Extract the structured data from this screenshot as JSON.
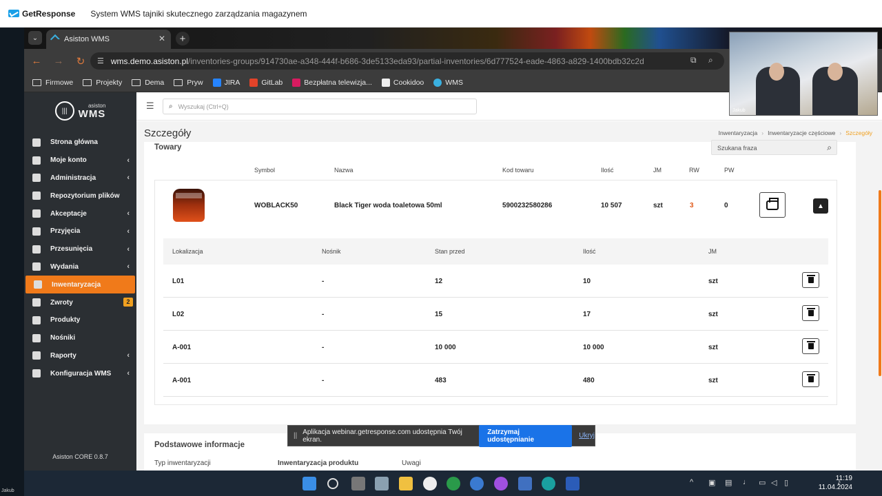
{
  "webinar": {
    "app": "GetResponse",
    "title": "System WMS tajniki skutecznego zarządzania magazynem"
  },
  "browser": {
    "tab_title": "Asiston WMS",
    "url_host": "wms.demo.asiston.pl",
    "url_path": "/inventories-groups/914730ae-a348-444f-b686-3de5133eda93/partial-inventories/6d777524-eade-4863-a829-1400bdb32c2d",
    "bookmarks": [
      "Firmowe",
      "Projekty",
      "Dema",
      "Pryw",
      "JIRA",
      "GitLab",
      "Bezpłatna telewizja...",
      "Cookidoo",
      "WMS"
    ]
  },
  "brand": {
    "small": "asiston",
    "big": "WMS"
  },
  "search": {
    "placeholder": "Wyszukaj (Ctrl+Q)"
  },
  "sidebar": {
    "items": [
      {
        "label": "Strona główna",
        "chevron": false
      },
      {
        "label": "Moje konto",
        "chevron": true
      },
      {
        "label": "Administracja",
        "chevron": true
      },
      {
        "label": "Repozytorium plików",
        "chevron": false
      },
      {
        "label": "Akceptacje",
        "chevron": true
      },
      {
        "label": "Przyjęcia",
        "chevron": true
      },
      {
        "label": "Przesunięcia",
        "chevron": true
      },
      {
        "label": "Wydania",
        "chevron": true
      },
      {
        "label": "Inwentaryzacja",
        "chevron": false,
        "active": true
      },
      {
        "label": "Zwroty",
        "badge": "2"
      },
      {
        "label": "Produkty",
        "chevron": false
      },
      {
        "label": "Nośniki",
        "chevron": false
      },
      {
        "label": "Raporty",
        "chevron": true
      },
      {
        "label": "Konfiguracja WMS",
        "chevron": true
      }
    ],
    "version": "Asiston CORE 0.8.7"
  },
  "page": {
    "title": "Szczegóły",
    "breadcrumbs": [
      "Inwentaryzacja",
      "Inwentaryzacje częściowe",
      "Szczegóły"
    ],
    "section": "Towary",
    "phrase_placeholder": "Szukana fraza"
  },
  "columns": {
    "symbol": "Symbol",
    "name": "Nazwa",
    "code": "Kod towaru",
    "qty": "Ilość",
    "unit": "JM",
    "rw": "RW",
    "pw": "PW"
  },
  "product": {
    "symbol": "WOBLACK50",
    "name": "Black Tiger woda toaletowa 50ml",
    "code": "5900232580286",
    "qty": "10 507",
    "unit": "szt",
    "rw": "3",
    "pw": "0"
  },
  "sub_columns": {
    "location": "Lokalizacja",
    "carrier": "Nośnik",
    "before": "Stan przed",
    "qty": "Ilość",
    "unit": "JM"
  },
  "locations": [
    {
      "location": "L01",
      "carrier": "-",
      "before": "12",
      "qty": "10",
      "unit": "szt"
    },
    {
      "location": "L02",
      "carrier": "-",
      "before": "15",
      "qty": "17",
      "unit": "szt"
    },
    {
      "location": "A-001",
      "carrier": "-",
      "before": "10 000",
      "qty": "10 000",
      "unit": "szt"
    },
    {
      "location": "A-001",
      "carrier": "-",
      "before": "483",
      "qty": "480",
      "unit": "szt"
    }
  ],
  "basic_info": {
    "title": "Podstawowe informacje",
    "f1": "Typ inwentaryzacji",
    "f2": "Inwentaryzacja produktu",
    "f3": "Uwagi"
  },
  "share_bar": {
    "text": "Aplikacja webinar.getresponse.com udostępnia Twój ekran.",
    "stop": "Zatrzymaj udostępnianie",
    "hide": "Ukryj"
  },
  "webcam": {
    "name": "Jakub"
  },
  "taskbar": {
    "time": "11:19",
    "date": "11.04.2024"
  },
  "colors": {
    "accent": "#f07a1a",
    "sidebar": "#2b2f33",
    "link": "#1a73e8"
  }
}
